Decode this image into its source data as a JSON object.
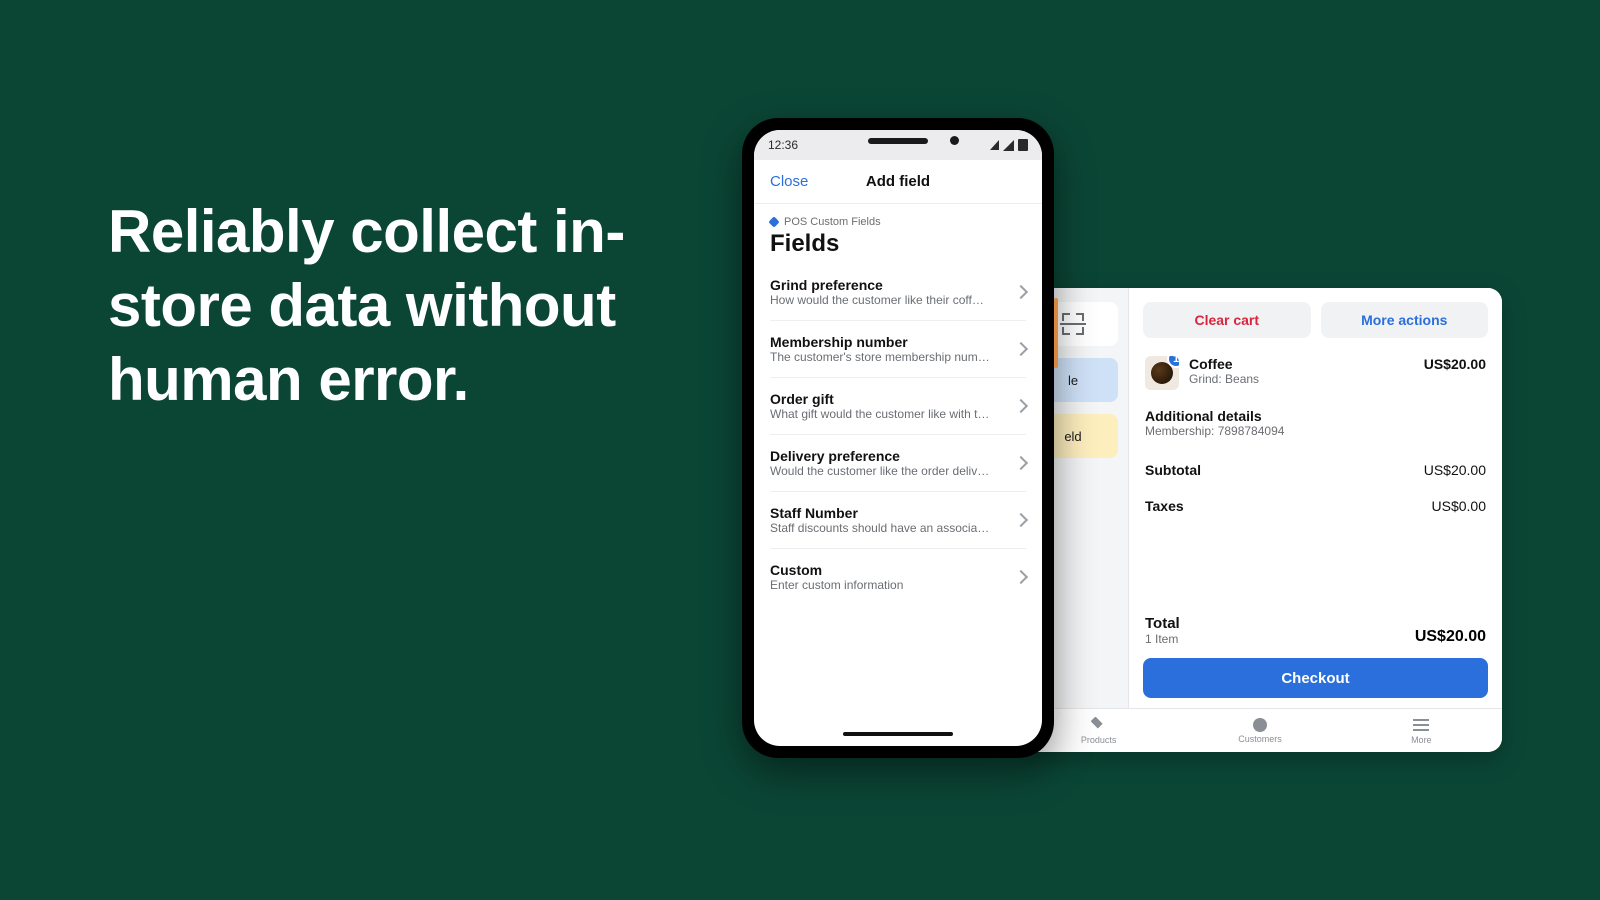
{
  "headline": "Reliably collect in-store data without human error.",
  "phone": {
    "status_time": "12:36",
    "nav": {
      "close": "Close",
      "title": "Add field"
    },
    "breadcrumb": "POS Custom Fields",
    "heading": "Fields",
    "fields": [
      {
        "title": "Grind preference",
        "subtitle": "How would the customer like their coffee bean…"
      },
      {
        "title": "Membership number",
        "subtitle": "The customer's store membership number"
      },
      {
        "title": "Order gift",
        "subtitle": "What gift would the customer like with their order"
      },
      {
        "title": "Delivery preference",
        "subtitle": "Would the customer like the order delivered?"
      },
      {
        "title": "Staff Number",
        "subtitle": "Staff discounts should have an associated sta…"
      },
      {
        "title": "Custom",
        "subtitle": "Enter custom information"
      }
    ]
  },
  "tablet": {
    "tiles": {
      "blue_suffix": "le",
      "yellow_suffix": "eld"
    },
    "actions": {
      "clear": "Clear cart",
      "more": "More actions"
    },
    "item": {
      "badge": "1",
      "title": "Coffee",
      "subtitle": "Grind: Beans",
      "price": "US$20.00"
    },
    "details": {
      "header": "Additional details",
      "line": "Membership: 7898784094"
    },
    "totals": {
      "subtotal_label": "Subtotal",
      "subtotal_value": "US$20.00",
      "taxes_label": "Taxes",
      "taxes_value": "US$0.00",
      "total_label": "Total",
      "total_sub": "1 Item",
      "total_value": "US$20.00"
    },
    "checkout": "Checkout",
    "tabs": {
      "products": "Products",
      "customers": "Customers",
      "more": "More"
    }
  }
}
